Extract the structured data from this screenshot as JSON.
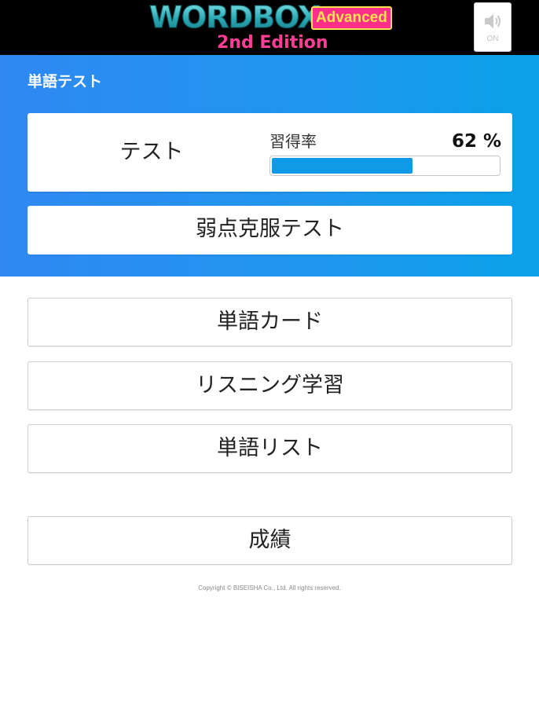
{
  "header": {
    "logo_title": "WORDBOX",
    "logo_badge": "Advanced",
    "logo_edition": "2nd Edition",
    "sound_toggle": {
      "icon": "speaker-icon",
      "label": "ON"
    }
  },
  "test_section": {
    "title": "単語テスト",
    "test_card": {
      "label": "テスト",
      "rate_label": "習得率",
      "rate_value": "62 %",
      "rate_percent": 62
    },
    "weak_point_button": "弱点克服テスト"
  },
  "menu": {
    "word_card": "単語カード",
    "listening": "リスニング学習",
    "word_list": "単語リスト",
    "results": "成績"
  },
  "footer": {
    "copyright": "Copyright © BISEISHA Co., Ltd. All rights reserved."
  },
  "colors": {
    "header_bg": "#000000",
    "section_gradient_start": "#2f88f2",
    "section_gradient_end": "#0aa1ea",
    "progress_fill": "#0f9ae8",
    "logo_pink": "#ff3d96",
    "logo_yellow": "#ffe14d",
    "logo_teal": "#3fc1c9"
  }
}
